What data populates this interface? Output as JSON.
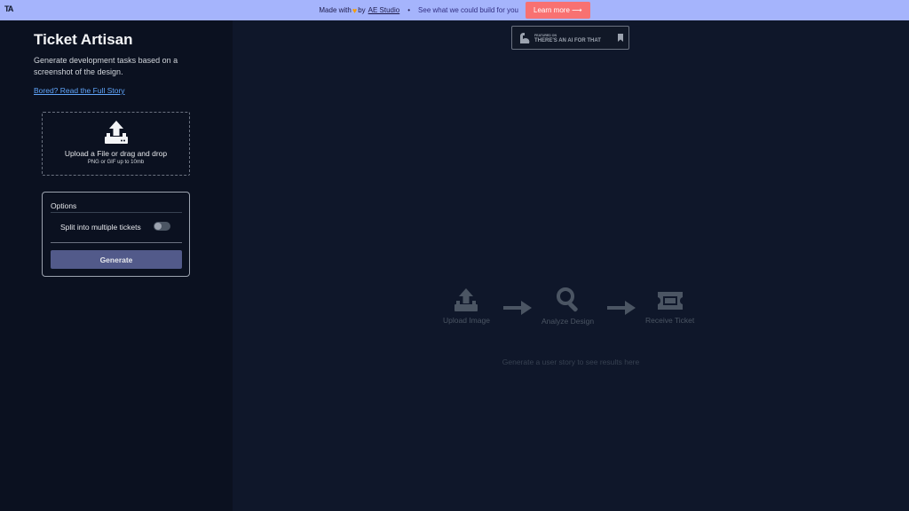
{
  "banner": {
    "logo": "TA",
    "made_with": "Made with",
    "by": "by",
    "studio": "AE Studio",
    "separator": "•",
    "tagline": "See what we could build for you",
    "learn_more": "Learn more ⟶"
  },
  "sidebar": {
    "title": "Ticket Artisan",
    "subtitle": "Generate development tasks based on a screenshot of the design.",
    "story_link": "Bored? Read the Full Story",
    "upload": {
      "label": "Upload a File or drag and drop",
      "sub": "PNG or GIF up to 10mb"
    },
    "options": {
      "title": "Options",
      "split_label": "Split into multiple tickets",
      "split_enabled": false,
      "generate_label": "Generate"
    }
  },
  "main": {
    "badge": {
      "small": "FEATURED ON",
      "big": "THERE'S AN AI FOR THAT"
    },
    "steps": [
      {
        "label": "Upload Image",
        "icon": "upload-icon"
      },
      {
        "label": "Analyze Design",
        "icon": "magnifier-icon"
      },
      {
        "label": "Receive Ticket",
        "icon": "ticket-icon"
      }
    ],
    "hint": "Generate a user story to see results here"
  },
  "colors": {
    "banner_bg": "#a5b4fc",
    "learn_btn": "#f87171",
    "sidebar_bg": "#0b1120",
    "main_bg": "#0f172a",
    "generate_btn": "#525a8a",
    "link": "#60a5fa"
  }
}
